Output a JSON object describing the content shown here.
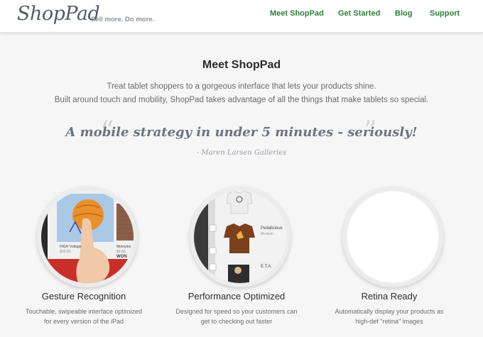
{
  "header": {
    "logo": "ShopPad",
    "tagline": "Sell more. Do more.",
    "nav": [
      {
        "label": "Meet ShopPad"
      },
      {
        "label": "Get Started"
      },
      {
        "label": "Blog"
      },
      {
        "label": "Support"
      }
    ]
  },
  "main": {
    "title": "Meet ShopPad",
    "intro_line1": "Treat tablet shoppers to a gorgeous interface that lets your products shine.",
    "intro_line2": "Built around touch and mobility, ShopPad takes advantage of all the things that make tablets so special.",
    "quote": "A mobile strategy in under 5 minutes - seriously!",
    "quote_open": "“",
    "quote_close": "”",
    "attribution": "- Maren Larsen Galleries"
  },
  "features": [
    {
      "title": "Gesture Recognition",
      "desc_line1": "Touchable, swipeable interface optimized",
      "desc_line2": "for every version of the iPad",
      "icon": "gesture-tablet-screenshot",
      "screenshot_text": {
        "product_name": "HIGH Voltage",
        "product_price": "$20.00",
        "side_name": "Motovino",
        "side_price": "$9.50",
        "side_fragment": "WON"
      }
    },
    {
      "title": "Performance Optimized",
      "desc_line1": "Designed for speed so your customers can",
      "desc_line2": "get to checking out faster",
      "icon": "performance-shirt-list-screenshot",
      "screenshot_text": {
        "item_name": "Pedalicious",
        "item_size": "Medium",
        "item2_name": "E.T.A."
      }
    },
    {
      "title": "Retina Ready",
      "desc_line1": "Automatically display your products as",
      "desc_line2": "high-def \"retina\" images",
      "icon": "retina-empty-circle"
    }
  ],
  "colors": {
    "nav": "#2f7f3a",
    "logo": "#555b66",
    "background": "#f6f6f6"
  }
}
